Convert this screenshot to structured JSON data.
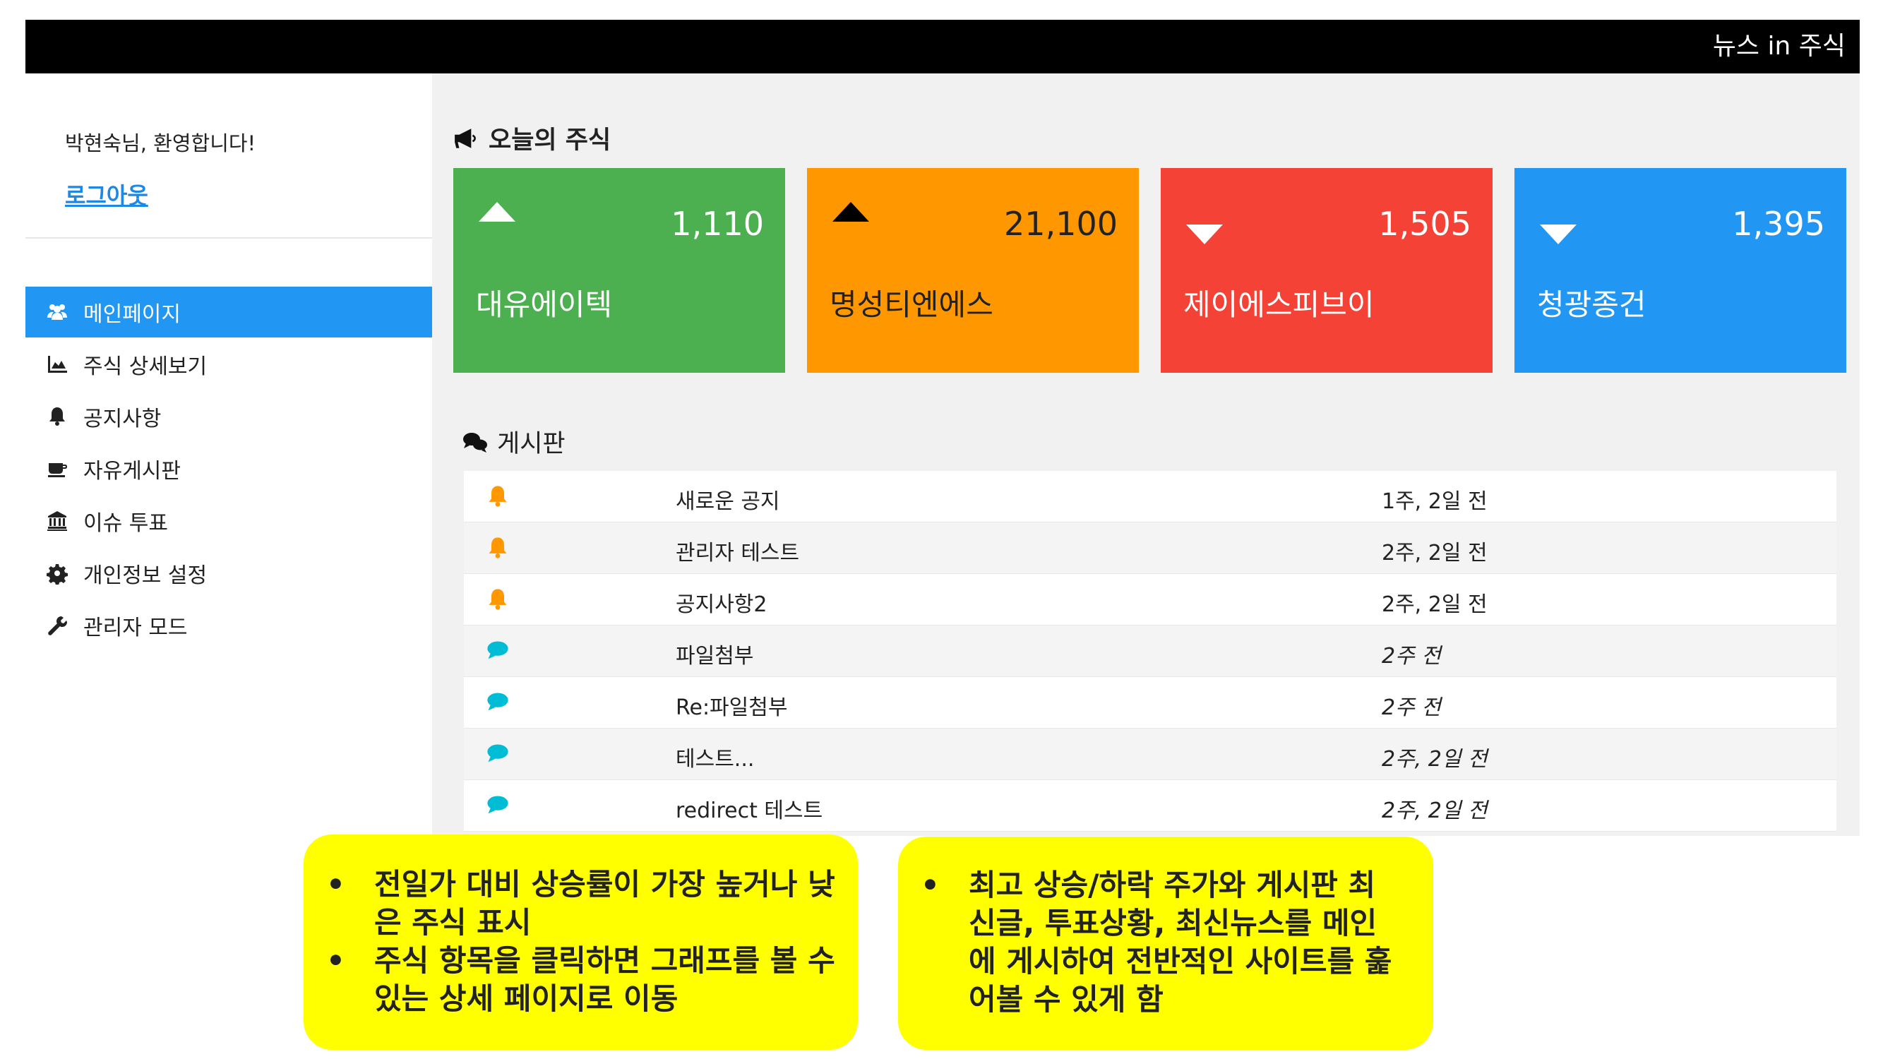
{
  "header": {
    "brand": "뉴스 in 주식"
  },
  "sidebar": {
    "welcome": "박현숙님, 환영합니다!",
    "logout": "로그아웃",
    "items": [
      {
        "label": "메인페이지",
        "icon": "users-icon",
        "active": true
      },
      {
        "label": "주식 상세보기",
        "icon": "area-chart-icon",
        "active": false
      },
      {
        "label": "공지사항",
        "icon": "bell-icon",
        "active": false
      },
      {
        "label": "자유게시판",
        "icon": "coffee-icon",
        "active": false
      },
      {
        "label": "이슈 투표",
        "icon": "bank-icon",
        "active": false
      },
      {
        "label": "개인정보 설정",
        "icon": "gear-icon",
        "active": false
      },
      {
        "label": "관리자 모드",
        "icon": "wrench-icon",
        "active": false
      }
    ]
  },
  "stocks": {
    "title": "오늘의 주식",
    "cards": [
      {
        "name": "대유에이텍",
        "price": "1,110",
        "direction": "up",
        "color": "#4caf50",
        "arrow_color": "#ffffff"
      },
      {
        "name": "명성티엔에스",
        "price": "21,100",
        "direction": "up",
        "color": "#ff9800",
        "arrow_color": "#000000"
      },
      {
        "name": "제이에스피브이",
        "price": "1,505",
        "direction": "down",
        "color": "#f44336",
        "arrow_color": "#ffffff"
      },
      {
        "name": "청광종건",
        "price": "1,395",
        "direction": "down",
        "color": "#2196f3",
        "arrow_color": "#ffffff"
      }
    ]
  },
  "board": {
    "title": "게시판",
    "rows": [
      {
        "icon": "bell-icon",
        "title": "새로운 공지",
        "date": "1주, 2일 전"
      },
      {
        "icon": "bell-icon",
        "title": "관리자 테스트",
        "date": "2주, 2일 전"
      },
      {
        "icon": "bell-icon",
        "title": "공지사항2",
        "date": "2주, 2일 전"
      },
      {
        "icon": "comment-icon",
        "title": "파일첨부",
        "date": "2주 전"
      },
      {
        "icon": "comment-icon",
        "title": "Re:파일첨부",
        "date": "2주 전"
      },
      {
        "icon": "comment-icon",
        "title": "테스트...",
        "date": "2주, 2일 전"
      },
      {
        "icon": "comment-icon",
        "title": "redirect 테스트",
        "date": "2주, 2일 전"
      }
    ]
  },
  "notes": [
    {
      "lines": [
        "전일가 대비 상승률이 가장 높거나 낮은 주식 표시",
        "주식 항목을 클릭하면 그래프를 볼 수 있는 상세 페이지로 이동"
      ]
    },
    {
      "lines": [
        "최고 상승/하락 주가와 게시판 최신글, 투표상황, 최신뉴스를 메인에 게시하여 전반적인 사이트를 훑어볼 수 있게 함"
      ]
    }
  ],
  "colors": {
    "accent": "#2196f3",
    "bell": "#ff9800",
    "comment": "#00bcd4",
    "note_bg": "#ffff00"
  }
}
